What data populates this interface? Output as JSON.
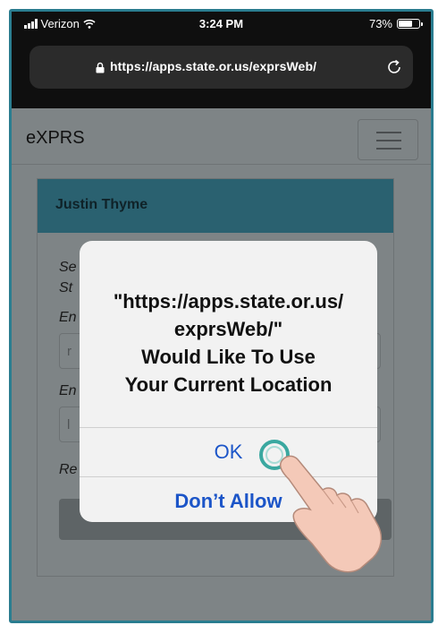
{
  "status_bar": {
    "carrier": "Verizon",
    "time": "3:24 PM",
    "battery_percent": "73%",
    "battery_level": 0.73
  },
  "browser": {
    "url": "https://apps.state.or.us/exprsWeb/"
  },
  "app": {
    "brand": "eXPRS",
    "user_name": "Justin Thyme",
    "form_fragments": {
      "line1": "Se",
      "line2": "St",
      "label1": "En",
      "field1_hint": "r",
      "label2": "En",
      "field2_hint": "l",
      "label3": "Re"
    }
  },
  "dialog": {
    "message_lines": [
      "\"https://apps.state.or.us/",
      "exprsWeb/\"",
      "Would Like To Use",
      "Your Current Location"
    ],
    "ok_label": "OK",
    "deny_label": "Don’t Allow"
  },
  "colors": {
    "frame": "#2a7d90",
    "dialog_button": "#1c55c8",
    "card_header": "#2a6170",
    "tap_ring": "#3aa8a0"
  }
}
